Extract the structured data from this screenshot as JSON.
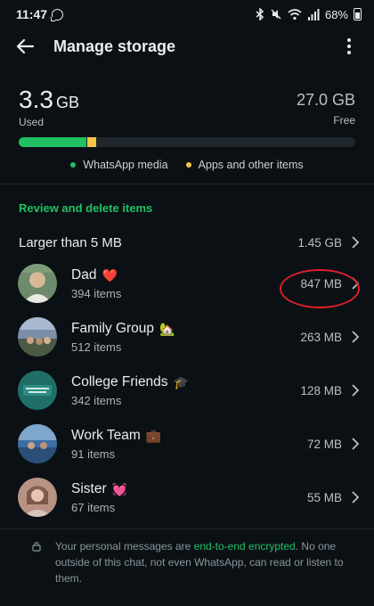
{
  "status_bar": {
    "time": "11:47",
    "battery": "68%"
  },
  "header": {
    "title": "Manage storage"
  },
  "storage": {
    "used_value": "3.3",
    "used_unit": "GB",
    "used_label": "Used",
    "free_value": "27.0 GB",
    "free_label": "Free",
    "whatsapp_media_fraction": 0.2,
    "apps_other_fraction": 0.025,
    "legend": [
      {
        "label": "WhatsApp media",
        "color": "#21c063"
      },
      {
        "label": "Apps and other items",
        "color": "#f7c443"
      }
    ]
  },
  "review": {
    "section_title": "Review and delete items",
    "larger_label": "Larger than 5 MB",
    "larger_size": "1.45 GB"
  },
  "chats": [
    {
      "name": "Dad",
      "emoji": "❤️",
      "items": "394 items",
      "size": "847 MB",
      "avatar": "dad"
    },
    {
      "name": "Family Group",
      "emoji": "🏡",
      "items": "512 items",
      "size": "263 MB",
      "avatar": "family"
    },
    {
      "name": "College Friends",
      "emoji": "🎓",
      "items": "342 items",
      "size": "128 MB",
      "avatar": "college"
    },
    {
      "name": "Work Team",
      "emoji": "💼",
      "items": "91 items",
      "size": "72 MB",
      "avatar": "work"
    },
    {
      "name": "Sister",
      "emoji": "💓",
      "items": "67 items",
      "size": "55 MB",
      "avatar": "sister"
    }
  ],
  "footer": {
    "text_before": "Your personal messages are ",
    "link_text": "end-to-end encrypted",
    "text_after": ". No one outside of this chat, not even WhatsApp, can read or listen to them."
  },
  "colors": {
    "accent": "#21c063",
    "apps_yellow": "#f7c443",
    "highlight_red": "#d8202b",
    "background": "#0b1014"
  }
}
